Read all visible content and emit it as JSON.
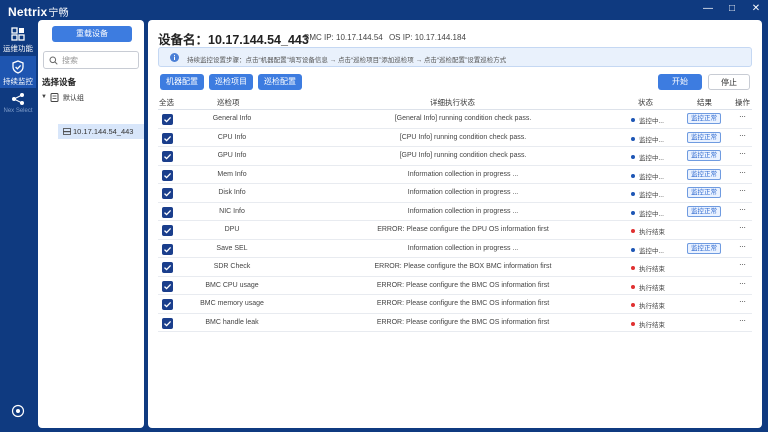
{
  "window": {
    "brand": "Nettrix",
    "brand_cn": "宁畅",
    "controls": [
      "—",
      "□",
      "✕"
    ]
  },
  "nav": [
    {
      "label": "运维功能",
      "icon": "grid-icon"
    },
    {
      "label": "持续监控",
      "icon": "shield-monitor-icon",
      "active": true
    },
    {
      "label": "Nex Select",
      "icon": "share-nodes-icon"
    }
  ],
  "device_panel": {
    "import_label": "重载设备",
    "search_placeholder": "搜索",
    "select_title": "选择设备",
    "group_label": "默认组",
    "device_label": "10.17.144.54_443"
  },
  "main": {
    "title": "设备名：10.17.144.54_443",
    "bmc_ip": "BMC IP: 10.17.144.54",
    "os_ip": "OS IP: 10.17.144.184",
    "notice": "持续监控设置步骤：点击“机器配置”填写设备信息 → 点击“巡检项目”添加巡检项 → 点击“巡检配置”设置巡检方式",
    "tabs": [
      "机器配置",
      "巡检项目",
      "巡检配置"
    ],
    "start_label": "开始",
    "stop_label": "停止",
    "columns": {
      "select_all": "全选",
      "item": "巡检项",
      "detail": "详细执行状态",
      "status": "状态",
      "result": "结果",
      "action": "操作"
    },
    "rows": [
      {
        "name": "General Info",
        "detail": "[General Info] running condition check pass.",
        "status": "监控中...",
        "status_color": "#1e56b5",
        "result": "监控正常",
        "op": "···"
      },
      {
        "name": "CPU Info",
        "detail": "[CPU Info] running condition check pass.",
        "status": "监控中...",
        "status_color": "#1e56b5",
        "result": "监控正常",
        "op": "···"
      },
      {
        "name": "GPU Info",
        "detail": "[GPU Info] running condition check pass.",
        "status": "监控中...",
        "status_color": "#1e56b5",
        "result": "监控正常",
        "op": "···"
      },
      {
        "name": "Mem Info",
        "detail": "Information collection in progress ...",
        "status": "监控中...",
        "status_color": "#1e56b5",
        "result": "监控正常",
        "op": "···"
      },
      {
        "name": "Disk Info",
        "detail": "Information collection in progress ...",
        "status": "监控中...",
        "status_color": "#1e56b5",
        "result": "监控正常",
        "op": "···"
      },
      {
        "name": "NIC Info",
        "detail": "Information collection in progress ...",
        "status": "监控中...",
        "status_color": "#1e56b5",
        "result": "监控正常",
        "op": "···"
      },
      {
        "name": "DPU",
        "detail": "ERROR: Please configure the DPU OS information first",
        "status": "执行结束",
        "status_color": "#e03131",
        "result": "",
        "op": "···"
      },
      {
        "name": "Save SEL",
        "detail": "Information collection in progress ...",
        "status": "监控中...",
        "status_color": "#1e56b5",
        "result": "监控正常",
        "op": "···"
      },
      {
        "name": "SDR Check",
        "detail": "ERROR: Please configure the BOX BMC information first",
        "status": "执行结束",
        "status_color": "#e03131",
        "result": "",
        "op": "···"
      },
      {
        "name": "BMC CPU usage",
        "detail": "ERROR: Please configure the BMC OS information first",
        "status": "执行结束",
        "status_color": "#e03131",
        "result": "",
        "op": "···"
      },
      {
        "name": "BMC memory usage",
        "detail": "ERROR: Please configure the BMC OS information first",
        "status": "执行结束",
        "status_color": "#e03131",
        "result": "",
        "op": "···"
      },
      {
        "name": "BMC handle leak",
        "detail": "ERROR: Please configure the BMC OS information first",
        "status": "执行结束",
        "status_color": "#e03131",
        "result": "",
        "op": "···"
      }
    ]
  }
}
